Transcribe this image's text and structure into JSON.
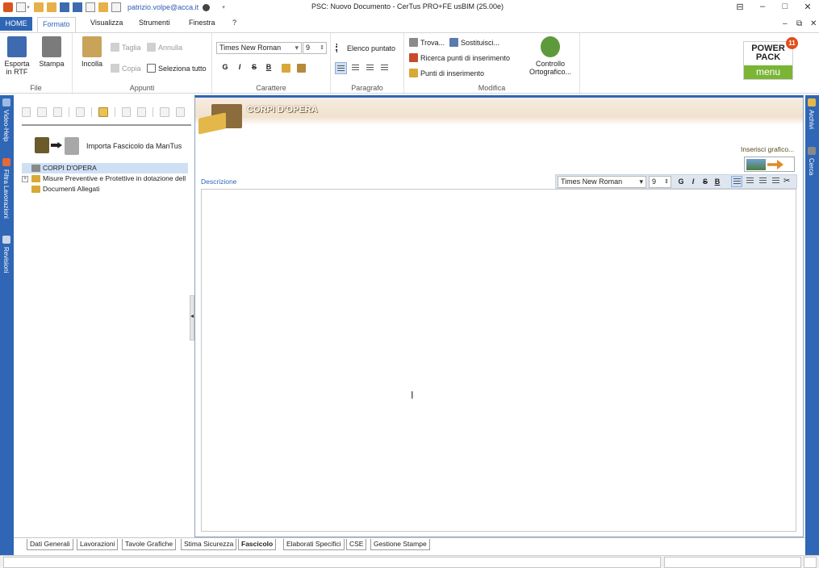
{
  "window": {
    "title": "PSC: Nuovo Documento - CerTus PRO+FE   usBIM (25.00e)",
    "user": "patrizio.volpe@acca.it"
  },
  "menu": {
    "home": "HOME",
    "tabs": [
      "Formato",
      "Visualizza",
      "Strumenti",
      "Finestra",
      "?"
    ]
  },
  "ribbon": {
    "file": {
      "label": "File",
      "export_rtf": "Esporta in RTF",
      "print": "Stampa"
    },
    "appunti": {
      "label": "Appunti",
      "paste": "Incolla",
      "cut": "Taglia",
      "undo": "Annulla",
      "copy": "Copia",
      "select_all": "Seleziona tutto"
    },
    "carattere": {
      "label": "Carattere",
      "font": "Times New Roman",
      "size": "9",
      "bold": "G",
      "italic": "I",
      "strike": "S",
      "underline": "B"
    },
    "paragrafo": {
      "label": "Paragrafo",
      "bullet_list": "Elenco puntato"
    },
    "modifica": {
      "label": "Modifica",
      "find": "Trova...",
      "replace": "Sostituisci...",
      "search_points": "Ricerca punti di inserimento",
      "insert_points": "Punti di inserimento",
      "spellcheck": "Controllo Ortografico..."
    },
    "powerpack": {
      "title_line1": "POWER",
      "title_line2": "PACK",
      "menu": "menu",
      "badge": "11"
    }
  },
  "left_rail": [
    "Video-Help",
    "Filtra Lavorazioni",
    "Revisioni"
  ],
  "right_rail": [
    "Archivi",
    "Cerca"
  ],
  "left_panel": {
    "import_label": "Importa Fascicolo da ManTus",
    "tree": [
      {
        "label": "CORPI D'OPERA",
        "selected": true,
        "expander": ""
      },
      {
        "label": "Misure Preventive e Protettive in dotazione dell",
        "selected": false,
        "expander": "+"
      },
      {
        "label": "Documenti Allegati",
        "selected": false,
        "expander": ""
      }
    ]
  },
  "main_panel": {
    "title": "CORPI D'OPERA",
    "insert_graphic": "Inserisci grafico...",
    "description_label": "Descrizione",
    "desc_toolbar": {
      "font": "Times New Roman",
      "size": "9",
      "bold": "G",
      "italic": "I",
      "strike": "S",
      "underline": "B"
    }
  },
  "bottom_tabs": [
    "Dati Generali",
    "Lavorazioni",
    "Tavole Grafiche",
    "Stima Sicurezza",
    "Fascicolo",
    "Elaborati Specifici",
    "CSE",
    "Gestione Stampe"
  ],
  "active_bottom_tab": "Fascicolo",
  "colors": {
    "accent": "#2f66b5",
    "powerpack_green": "#7ab536",
    "badge": "#e04e1c"
  }
}
